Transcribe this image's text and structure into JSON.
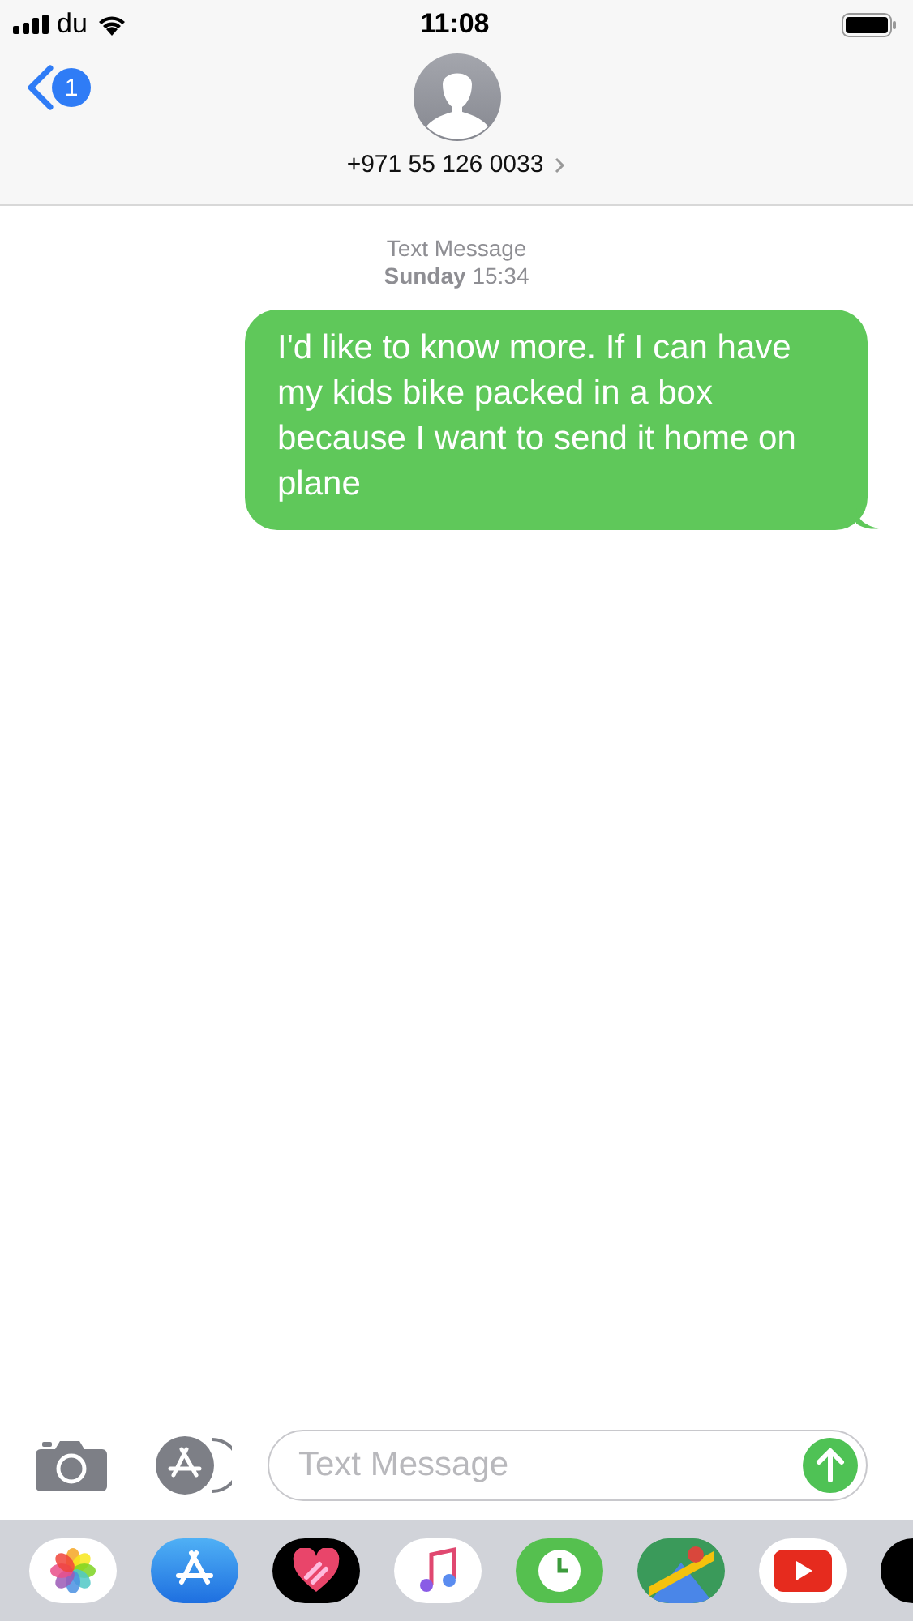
{
  "status_bar": {
    "carrier": "du",
    "time": "11:08"
  },
  "header": {
    "back_badge": "1",
    "contact": "+971 55 126 0033"
  },
  "thread": {
    "service": "Text Message",
    "timestamp": "**Sunday** 15:34"
  },
  "messages": [
    {
      "kind": "sent",
      "text": "I'd like to know more. If I can have my kids bike packed in a box because I want to send it home on plane"
    }
  ],
  "composer": {
    "placeholder": "Text Message"
  }
}
